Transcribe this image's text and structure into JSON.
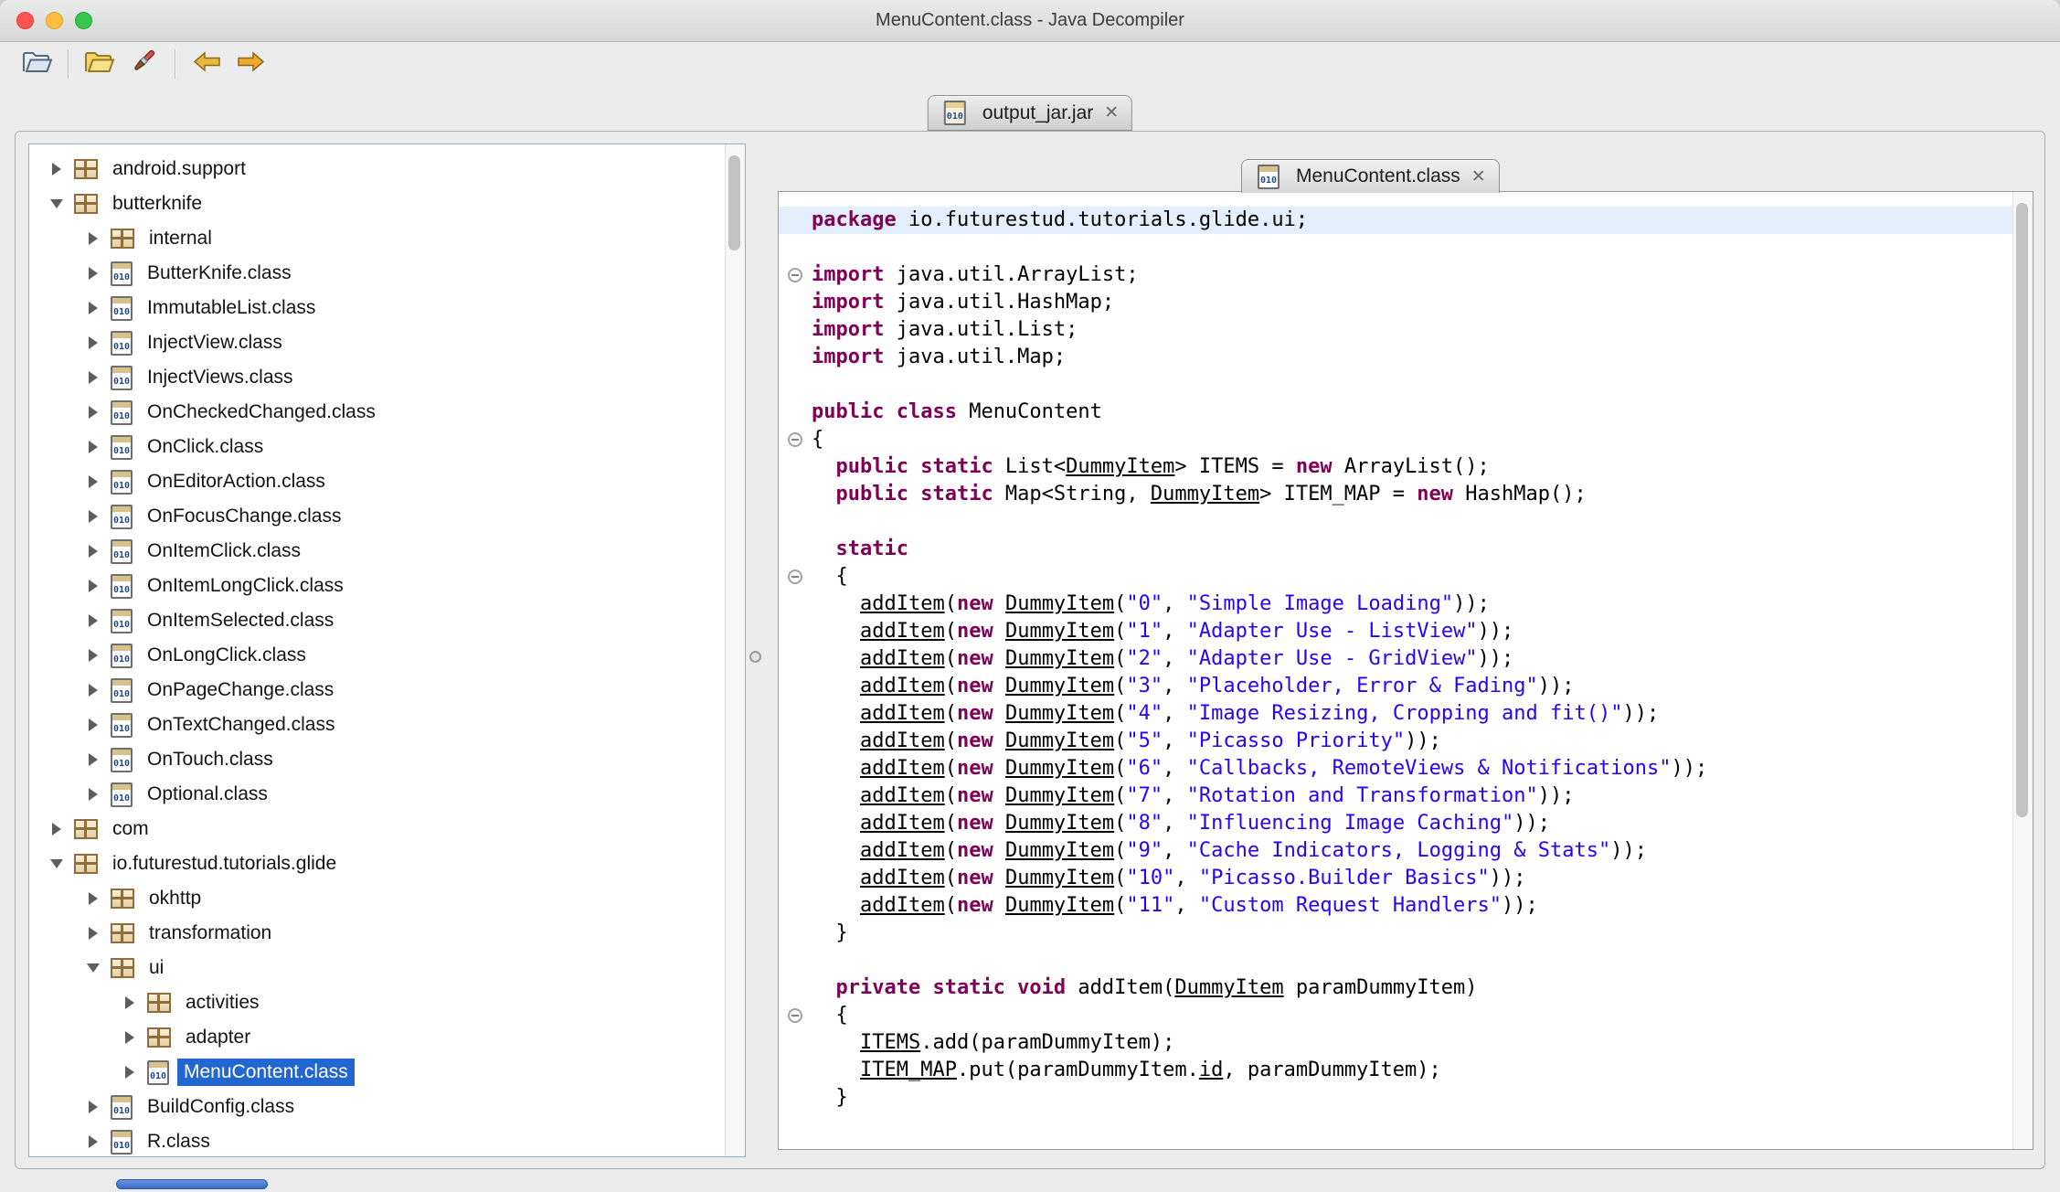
{
  "window": {
    "title": "MenuContent.class - Java Decompiler"
  },
  "toolbar": {
    "buttons": [
      {
        "name": "open-file-button",
        "icon": "open-folder-icon"
      },
      {
        "name": "open-jar-button",
        "icon": "archive-folder-icon"
      },
      {
        "name": "save-sources-button",
        "icon": "brush-icon"
      },
      {
        "name": "back-button",
        "icon": "arrow-left-icon"
      },
      {
        "name": "forward-button",
        "icon": "arrow-right-icon"
      }
    ]
  },
  "jar_tab": {
    "label": "output_jar.jar",
    "close": "✕"
  },
  "source_tab": {
    "label": "MenuContent.class",
    "close": "✕"
  },
  "icons": {
    "class_glyph": "010"
  },
  "colors": {
    "keyword": "#7f0055",
    "string": "#2a00ff",
    "selection": "#2166d1",
    "line_highlight": "#e3effd"
  },
  "tree": {
    "items": [
      {
        "label": "android.support",
        "level": 0,
        "arrow": "collapsed",
        "icon": "package"
      },
      {
        "label": "butterknife",
        "level": 0,
        "arrow": "expanded",
        "icon": "package"
      },
      {
        "label": "internal",
        "level": 1,
        "arrow": "collapsed",
        "icon": "package"
      },
      {
        "label": "ButterKnife.class",
        "level": 1,
        "arrow": "collapsed",
        "icon": "class"
      },
      {
        "label": "ImmutableList.class",
        "level": 1,
        "arrow": "collapsed",
        "icon": "class"
      },
      {
        "label": "InjectView.class",
        "level": 1,
        "arrow": "collapsed",
        "icon": "class"
      },
      {
        "label": "InjectViews.class",
        "level": 1,
        "arrow": "collapsed",
        "icon": "class"
      },
      {
        "label": "OnCheckedChanged.class",
        "level": 1,
        "arrow": "collapsed",
        "icon": "class"
      },
      {
        "label": "OnClick.class",
        "level": 1,
        "arrow": "collapsed",
        "icon": "class"
      },
      {
        "label": "OnEditorAction.class",
        "level": 1,
        "arrow": "collapsed",
        "icon": "class"
      },
      {
        "label": "OnFocusChange.class",
        "level": 1,
        "arrow": "collapsed",
        "icon": "class"
      },
      {
        "label": "OnItemClick.class",
        "level": 1,
        "arrow": "collapsed",
        "icon": "class"
      },
      {
        "label": "OnItemLongClick.class",
        "level": 1,
        "arrow": "collapsed",
        "icon": "class"
      },
      {
        "label": "OnItemSelected.class",
        "level": 1,
        "arrow": "collapsed",
        "icon": "class"
      },
      {
        "label": "OnLongClick.class",
        "level": 1,
        "arrow": "collapsed",
        "icon": "class"
      },
      {
        "label": "OnPageChange.class",
        "level": 1,
        "arrow": "collapsed",
        "icon": "class"
      },
      {
        "label": "OnTextChanged.class",
        "level": 1,
        "arrow": "collapsed",
        "icon": "class"
      },
      {
        "label": "OnTouch.class",
        "level": 1,
        "arrow": "collapsed",
        "icon": "class"
      },
      {
        "label": "Optional.class",
        "level": 1,
        "arrow": "collapsed",
        "icon": "class"
      },
      {
        "label": "com",
        "level": 0,
        "arrow": "collapsed",
        "icon": "package"
      },
      {
        "label": "io.futurestud.tutorials.glide",
        "level": 0,
        "arrow": "expanded",
        "icon": "package"
      },
      {
        "label": "okhttp",
        "level": 1,
        "arrow": "collapsed",
        "icon": "package"
      },
      {
        "label": "transformation",
        "level": 1,
        "arrow": "collapsed",
        "icon": "package"
      },
      {
        "label": "ui",
        "level": 1,
        "arrow": "expanded",
        "icon": "package"
      },
      {
        "label": "activities",
        "level": 2,
        "arrow": "collapsed",
        "icon": "package"
      },
      {
        "label": "adapter",
        "level": 2,
        "arrow": "collapsed",
        "icon": "package"
      },
      {
        "label": "MenuContent.class",
        "level": 2,
        "arrow": "collapsed",
        "icon": "class",
        "selected": true
      },
      {
        "label": "BuildConfig.class",
        "level": 1,
        "arrow": "collapsed",
        "icon": "class"
      },
      {
        "label": "R.class",
        "level": 1,
        "arrow": "collapsed",
        "icon": "class"
      }
    ]
  },
  "code": {
    "lines": [
      {
        "highlight": true,
        "segments": [
          [
            "k",
            "package"
          ],
          [
            "p",
            " io.futurestud.tutorials.glide.ui;"
          ]
        ]
      },
      {
        "segments": []
      },
      {
        "fold": true,
        "segments": [
          [
            "k",
            "import"
          ],
          [
            "p",
            " java.util.ArrayList;"
          ]
        ]
      },
      {
        "segments": [
          [
            "k",
            "import"
          ],
          [
            "p",
            " java.util.HashMap;"
          ]
        ]
      },
      {
        "segments": [
          [
            "k",
            "import"
          ],
          [
            "p",
            " java.util.List;"
          ]
        ]
      },
      {
        "segments": [
          [
            "k",
            "import"
          ],
          [
            "p",
            " java.util.Map;"
          ]
        ]
      },
      {
        "segments": []
      },
      {
        "segments": [
          [
            "k",
            "public class"
          ],
          [
            "p",
            " MenuContent"
          ]
        ]
      },
      {
        "fold": true,
        "segments": [
          [
            "p",
            "{"
          ]
        ]
      },
      {
        "segments": [
          [
            "p",
            "  "
          ],
          [
            "k",
            "public static"
          ],
          [
            "p",
            " List<"
          ],
          [
            "u",
            "DummyItem"
          ],
          [
            "p",
            "> ITEMS = "
          ],
          [
            "k",
            "new"
          ],
          [
            "p",
            " ArrayList();"
          ]
        ]
      },
      {
        "segments": [
          [
            "p",
            "  "
          ],
          [
            "k",
            "public static"
          ],
          [
            "p",
            " Map<String, "
          ],
          [
            "u",
            "DummyItem"
          ],
          [
            "p",
            "> ITEM_MAP = "
          ],
          [
            "k",
            "new"
          ],
          [
            "p",
            " HashMap();"
          ]
        ]
      },
      {
        "segments": []
      },
      {
        "segments": [
          [
            "p",
            "  "
          ],
          [
            "k",
            "static"
          ]
        ]
      },
      {
        "fold": true,
        "segments": [
          [
            "p",
            "  {"
          ]
        ]
      },
      {
        "segments": [
          [
            "p",
            "    "
          ],
          [
            "u",
            "addItem"
          ],
          [
            "p",
            "("
          ],
          [
            "k",
            "new"
          ],
          [
            "p",
            " "
          ],
          [
            "u",
            "DummyItem"
          ],
          [
            "p",
            "("
          ],
          [
            "s",
            "\"0\""
          ],
          [
            "p",
            ", "
          ],
          [
            "s",
            "\"Simple Image Loading\""
          ],
          [
            "p",
            "));"
          ]
        ]
      },
      {
        "segments": [
          [
            "p",
            "    "
          ],
          [
            "u",
            "addItem"
          ],
          [
            "p",
            "("
          ],
          [
            "k",
            "new"
          ],
          [
            "p",
            " "
          ],
          [
            "u",
            "DummyItem"
          ],
          [
            "p",
            "("
          ],
          [
            "s",
            "\"1\""
          ],
          [
            "p",
            ", "
          ],
          [
            "s",
            "\"Adapter Use - ListView\""
          ],
          [
            "p",
            "));"
          ]
        ]
      },
      {
        "segments": [
          [
            "p",
            "    "
          ],
          [
            "u",
            "addItem"
          ],
          [
            "p",
            "("
          ],
          [
            "k",
            "new"
          ],
          [
            "p",
            " "
          ],
          [
            "u",
            "DummyItem"
          ],
          [
            "p",
            "("
          ],
          [
            "s",
            "\"2\""
          ],
          [
            "p",
            ", "
          ],
          [
            "s",
            "\"Adapter Use - GridView\""
          ],
          [
            "p",
            "));"
          ]
        ]
      },
      {
        "segments": [
          [
            "p",
            "    "
          ],
          [
            "u",
            "addItem"
          ],
          [
            "p",
            "("
          ],
          [
            "k",
            "new"
          ],
          [
            "p",
            " "
          ],
          [
            "u",
            "DummyItem"
          ],
          [
            "p",
            "("
          ],
          [
            "s",
            "\"3\""
          ],
          [
            "p",
            ", "
          ],
          [
            "s",
            "\"Placeholder, Error & Fading\""
          ],
          [
            "p",
            "));"
          ]
        ]
      },
      {
        "segments": [
          [
            "p",
            "    "
          ],
          [
            "u",
            "addItem"
          ],
          [
            "p",
            "("
          ],
          [
            "k",
            "new"
          ],
          [
            "p",
            " "
          ],
          [
            "u",
            "DummyItem"
          ],
          [
            "p",
            "("
          ],
          [
            "s",
            "\"4\""
          ],
          [
            "p",
            ", "
          ],
          [
            "s",
            "\"Image Resizing, Cropping and fit()\""
          ],
          [
            "p",
            "));"
          ]
        ]
      },
      {
        "segments": [
          [
            "p",
            "    "
          ],
          [
            "u",
            "addItem"
          ],
          [
            "p",
            "("
          ],
          [
            "k",
            "new"
          ],
          [
            "p",
            " "
          ],
          [
            "u",
            "DummyItem"
          ],
          [
            "p",
            "("
          ],
          [
            "s",
            "\"5\""
          ],
          [
            "p",
            ", "
          ],
          [
            "s",
            "\"Picasso Priority\""
          ],
          [
            "p",
            "));"
          ]
        ]
      },
      {
        "segments": [
          [
            "p",
            "    "
          ],
          [
            "u",
            "addItem"
          ],
          [
            "p",
            "("
          ],
          [
            "k",
            "new"
          ],
          [
            "p",
            " "
          ],
          [
            "u",
            "DummyItem"
          ],
          [
            "p",
            "("
          ],
          [
            "s",
            "\"6\""
          ],
          [
            "p",
            ", "
          ],
          [
            "s",
            "\"Callbacks, RemoteViews & Notifications\""
          ],
          [
            "p",
            "));"
          ]
        ]
      },
      {
        "segments": [
          [
            "p",
            "    "
          ],
          [
            "u",
            "addItem"
          ],
          [
            "p",
            "("
          ],
          [
            "k",
            "new"
          ],
          [
            "p",
            " "
          ],
          [
            "u",
            "DummyItem"
          ],
          [
            "p",
            "("
          ],
          [
            "s",
            "\"7\""
          ],
          [
            "p",
            ", "
          ],
          [
            "s",
            "\"Rotation and Transformation\""
          ],
          [
            "p",
            "));"
          ]
        ]
      },
      {
        "segments": [
          [
            "p",
            "    "
          ],
          [
            "u",
            "addItem"
          ],
          [
            "p",
            "("
          ],
          [
            "k",
            "new"
          ],
          [
            "p",
            " "
          ],
          [
            "u",
            "DummyItem"
          ],
          [
            "p",
            "("
          ],
          [
            "s",
            "\"8\""
          ],
          [
            "p",
            ", "
          ],
          [
            "s",
            "\"Influencing Image Caching\""
          ],
          [
            "p",
            "));"
          ]
        ]
      },
      {
        "segments": [
          [
            "p",
            "    "
          ],
          [
            "u",
            "addItem"
          ],
          [
            "p",
            "("
          ],
          [
            "k",
            "new"
          ],
          [
            "p",
            " "
          ],
          [
            "u",
            "DummyItem"
          ],
          [
            "p",
            "("
          ],
          [
            "s",
            "\"9\""
          ],
          [
            "p",
            ", "
          ],
          [
            "s",
            "\"Cache Indicators, Logging & Stats\""
          ],
          [
            "p",
            "));"
          ]
        ]
      },
      {
        "segments": [
          [
            "p",
            "    "
          ],
          [
            "u",
            "addItem"
          ],
          [
            "p",
            "("
          ],
          [
            "k",
            "new"
          ],
          [
            "p",
            " "
          ],
          [
            "u",
            "DummyItem"
          ],
          [
            "p",
            "("
          ],
          [
            "s",
            "\"10\""
          ],
          [
            "p",
            ", "
          ],
          [
            "s",
            "\"Picasso.Builder Basics\""
          ],
          [
            "p",
            "));"
          ]
        ]
      },
      {
        "segments": [
          [
            "p",
            "    "
          ],
          [
            "u",
            "addItem"
          ],
          [
            "p",
            "("
          ],
          [
            "k",
            "new"
          ],
          [
            "p",
            " "
          ],
          [
            "u",
            "DummyItem"
          ],
          [
            "p",
            "("
          ],
          [
            "s",
            "\"11\""
          ],
          [
            "p",
            ", "
          ],
          [
            "s",
            "\"Custom Request Handlers\""
          ],
          [
            "p",
            "));"
          ]
        ]
      },
      {
        "segments": [
          [
            "p",
            "  }"
          ]
        ]
      },
      {
        "segments": []
      },
      {
        "segments": [
          [
            "p",
            "  "
          ],
          [
            "k",
            "private static void"
          ],
          [
            "p",
            " addItem("
          ],
          [
            "u",
            "DummyItem"
          ],
          [
            "p",
            " paramDummyItem)"
          ]
        ]
      },
      {
        "fold": true,
        "segments": [
          [
            "p",
            "  {"
          ]
        ]
      },
      {
        "segments": [
          [
            "p",
            "    "
          ],
          [
            "u",
            "ITEMS"
          ],
          [
            "p",
            ".add(paramDummyItem);"
          ]
        ]
      },
      {
        "segments": [
          [
            "p",
            "    "
          ],
          [
            "u",
            "ITEM_MAP"
          ],
          [
            "p",
            ".put(paramDummyItem."
          ],
          [
            "u",
            "id"
          ],
          [
            "p",
            ", paramDummyItem);"
          ]
        ]
      },
      {
        "segments": [
          [
            "p",
            "  }"
          ]
        ]
      }
    ]
  }
}
